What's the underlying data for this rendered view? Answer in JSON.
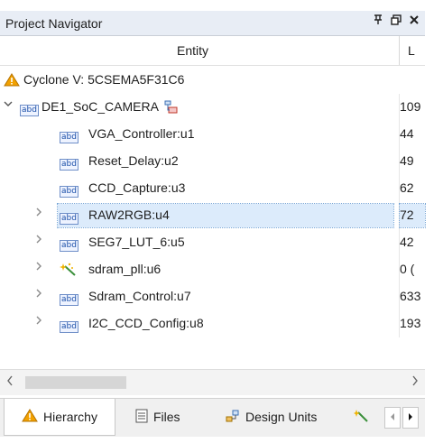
{
  "panel": {
    "title": "Project Navigator",
    "buttons": {
      "pin": "ᒧ",
      "float": "▭",
      "close": "×"
    }
  },
  "columns": {
    "entity": "Entity",
    "col2": "L"
  },
  "device": {
    "label": "Cyclone V: 5CSEMA5F31C6"
  },
  "top_entity": {
    "label": "DE1_SoC_CAMERA",
    "value": "109"
  },
  "items": [
    {
      "label": "VGA_Controller:u1",
      "value": "44",
      "expandable": false,
      "icon": "abd-icon"
    },
    {
      "label": "Reset_Delay:u2",
      "value": "49",
      "expandable": false,
      "icon": "abd-icon"
    },
    {
      "label": "CCD_Capture:u3",
      "value": "62",
      "expandable": false,
      "icon": "abd-icon"
    },
    {
      "label": "RAW2RGB:u4",
      "value": "72",
      "expandable": true,
      "icon": "abd-icon",
      "selected": true
    },
    {
      "label": "SEG7_LUT_6:u5",
      "value": "42",
      "expandable": true,
      "icon": "abd-icon"
    },
    {
      "label": "sdram_pll:u6",
      "value": "0 (",
      "expandable": true,
      "icon": "wand-icon"
    },
    {
      "label": "Sdram_Control:u7",
      "value": "633",
      "expandable": true,
      "icon": "abd-icon"
    },
    {
      "label": "I2C_CCD_Config:u8",
      "value": "193",
      "expandable": true,
      "icon": "abd-icon"
    }
  ],
  "tabs": [
    {
      "label": "Hierarchy",
      "icon": "warning-triangle-icon",
      "active": true
    },
    {
      "label": "Files",
      "icon": "document-icon"
    },
    {
      "label": "Design Units",
      "icon": "units-icon"
    }
  ],
  "colors": {
    "selection": "#dcebfb",
    "title_bar": "#e8edf5",
    "warning": "#f2a100"
  }
}
